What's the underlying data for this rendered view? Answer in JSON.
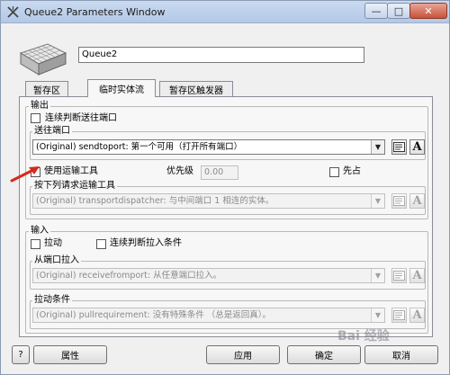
{
  "window": {
    "title": "Queue2  Parameters Window",
    "buttons": {
      "minimize": "—",
      "maximize": "□",
      "close": "✕"
    }
  },
  "header": {
    "name_value": "Queue2"
  },
  "tabs": [
    {
      "label": "暂存区",
      "active": false
    },
    {
      "label": "临时实体流",
      "active": true
    },
    {
      "label": "暂存区触发器",
      "active": false
    }
  ],
  "output": {
    "title": "输出",
    "continuous_eval_label": "连续判断送往端口",
    "sendto": {
      "title": "送往端口",
      "value": "(Original) sendtoport:  第一个可用（打开所有端口）"
    },
    "use_transport_label": "使用运输工具",
    "priority_label": "优先级",
    "priority_value": "0.00",
    "preempt_label": "先占",
    "request_transport": {
      "title": "按下列请求运输工具",
      "value": "(Original) transportdispatcher:  与中间端口 1  相连的实体。"
    }
  },
  "input": {
    "title": "输入",
    "pull_label": "拉动",
    "continuous_pull_label": "连续判断拉入条件",
    "pull_from": {
      "title": "从端口拉入",
      "value": "(Original) receivefromport:  从任意端口拉入。"
    },
    "pull_condition": {
      "title": "拉动条件",
      "value": "(Original) pullrequirement:  没有特殊条件  （总是返回真）。"
    }
  },
  "footer": {
    "help_label": "?",
    "properties_label": "属性",
    "apply_label": "应用",
    "ok_label": "确定",
    "cancel_label": "取消"
  },
  "watermark": "Bai 经验"
}
